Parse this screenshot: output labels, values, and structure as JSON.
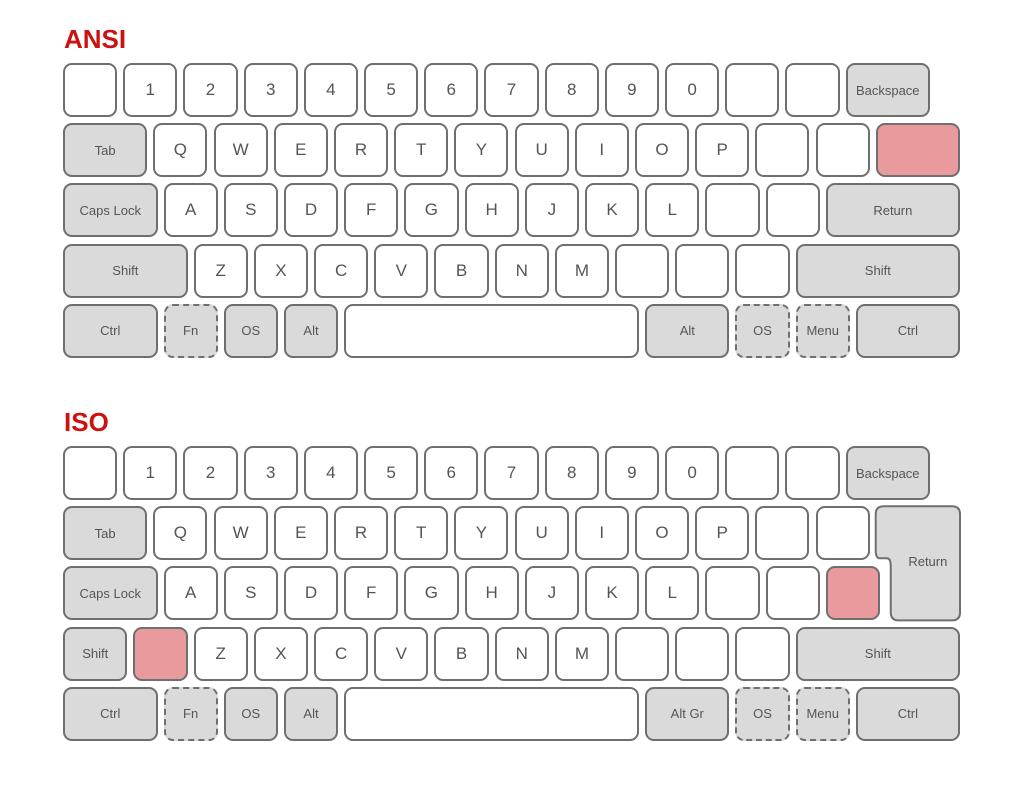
{
  "colors": {
    "title": "#cc1111",
    "modifier": "#dadada",
    "highlight": "#e99a9c",
    "key": "#ffffff",
    "border": "#6f6f6f"
  },
  "ansi": {
    "title": "ANSI",
    "rows": [
      [
        {
          "l": "",
          "w": 1
        },
        {
          "l": "1",
          "w": 1
        },
        {
          "l": "2",
          "w": 1
        },
        {
          "l": "3",
          "w": 1
        },
        {
          "l": "4",
          "w": 1
        },
        {
          "l": "5",
          "w": 1
        },
        {
          "l": "6",
          "w": 1
        },
        {
          "l": "7",
          "w": 1
        },
        {
          "l": "8",
          "w": 1
        },
        {
          "l": "9",
          "w": 1
        },
        {
          "l": "0",
          "w": 1
        },
        {
          "l": "",
          "w": 1
        },
        {
          "l": "",
          "w": 1
        },
        {
          "l": "Backspace",
          "w": 1.5,
          "mod": true
        }
      ],
      [
        {
          "l": "Tab",
          "w": 1.5,
          "mod": true
        },
        {
          "l": "Q",
          "w": 1
        },
        {
          "l": "W",
          "w": 1
        },
        {
          "l": "E",
          "w": 1
        },
        {
          "l": "R",
          "w": 1
        },
        {
          "l": "T",
          "w": 1
        },
        {
          "l": "Y",
          "w": 1
        },
        {
          "l": "U",
          "w": 1
        },
        {
          "l": "I",
          "w": 1
        },
        {
          "l": "O",
          "w": 1
        },
        {
          "l": "P",
          "w": 1
        },
        {
          "l": "",
          "w": 1
        },
        {
          "l": "",
          "w": 1
        },
        {
          "l": "",
          "w": 1.5,
          "hl": true
        }
      ],
      [
        {
          "l": "Caps Lock",
          "w": 1.67,
          "mod": true
        },
        {
          "l": "A",
          "w": 1
        },
        {
          "l": "S",
          "w": 1
        },
        {
          "l": "D",
          "w": 1
        },
        {
          "l": "F",
          "w": 1
        },
        {
          "l": "G",
          "w": 1
        },
        {
          "l": "H",
          "w": 1
        },
        {
          "l": "J",
          "w": 1
        },
        {
          "l": "K",
          "w": 1
        },
        {
          "l": "L",
          "w": 1
        },
        {
          "l": "",
          "w": 1
        },
        {
          "l": "",
          "w": 1
        },
        {
          "l": "Return",
          "w": 2.33,
          "mod": true
        }
      ],
      [
        {
          "l": "Shift",
          "w": 2.17,
          "mod": true
        },
        {
          "l": "Z",
          "w": 1
        },
        {
          "l": "X",
          "w": 1
        },
        {
          "l": "C",
          "w": 1
        },
        {
          "l": "V",
          "w": 1
        },
        {
          "l": "B",
          "w": 1
        },
        {
          "l": "N",
          "w": 1
        },
        {
          "l": "M",
          "w": 1
        },
        {
          "l": "",
          "w": 1
        },
        {
          "l": "",
          "w": 1
        },
        {
          "l": "",
          "w": 1
        },
        {
          "l": "Shift",
          "w": 2.83,
          "mod": true
        }
      ],
      [
        {
          "l": "Ctrl",
          "w": 1.67,
          "mod": true
        },
        {
          "l": "Fn",
          "w": 1,
          "mod": true,
          "dashed": true
        },
        {
          "l": "OS",
          "w": 1,
          "mod": true
        },
        {
          "l": "Alt",
          "w": 1,
          "mod": true
        },
        {
          "l": "",
          "w": 5
        },
        {
          "l": "Alt",
          "w": 1.5,
          "mod": true
        },
        {
          "l": "OS",
          "w": 1,
          "mod": true,
          "dashed": true
        },
        {
          "l": "Menu",
          "w": 1,
          "mod": true,
          "dashed": true
        },
        {
          "l": "Ctrl",
          "w": 1.83,
          "mod": true
        }
      ]
    ]
  },
  "iso": {
    "title": "ISO",
    "return_label": "Return",
    "rows": [
      [
        {
          "l": "",
          "w": 1
        },
        {
          "l": "1",
          "w": 1
        },
        {
          "l": "2",
          "w": 1
        },
        {
          "l": "3",
          "w": 1
        },
        {
          "l": "4",
          "w": 1
        },
        {
          "l": "5",
          "w": 1
        },
        {
          "l": "6",
          "w": 1
        },
        {
          "l": "7",
          "w": 1
        },
        {
          "l": "8",
          "w": 1
        },
        {
          "l": "9",
          "w": 1
        },
        {
          "l": "0",
          "w": 1
        },
        {
          "l": "",
          "w": 1
        },
        {
          "l": "",
          "w": 1
        },
        {
          "l": "Backspace",
          "w": 1.5,
          "mod": true
        }
      ],
      [
        {
          "l": "Tab",
          "w": 1.5,
          "mod": true
        },
        {
          "l": "Q",
          "w": 1
        },
        {
          "l": "W",
          "w": 1
        },
        {
          "l": "E",
          "w": 1
        },
        {
          "l": "R",
          "w": 1
        },
        {
          "l": "T",
          "w": 1
        },
        {
          "l": "Y",
          "w": 1
        },
        {
          "l": "U",
          "w": 1
        },
        {
          "l": "I",
          "w": 1
        },
        {
          "l": "O",
          "w": 1
        },
        {
          "l": "P",
          "w": 1
        },
        {
          "l": "",
          "w": 1
        },
        {
          "l": "",
          "w": 1
        }
      ],
      [
        {
          "l": "Caps Lock",
          "w": 1.67,
          "mod": true
        },
        {
          "l": "A",
          "w": 1
        },
        {
          "l": "S",
          "w": 1
        },
        {
          "l": "D",
          "w": 1
        },
        {
          "l": "F",
          "w": 1
        },
        {
          "l": "G",
          "w": 1
        },
        {
          "l": "H",
          "w": 1
        },
        {
          "l": "J",
          "w": 1
        },
        {
          "l": "K",
          "w": 1
        },
        {
          "l": "L",
          "w": 1
        },
        {
          "l": "",
          "w": 1
        },
        {
          "l": "",
          "w": 1
        },
        {
          "l": "",
          "w": 1,
          "hl": true
        }
      ],
      [
        {
          "l": "Shift",
          "w": 1.17,
          "mod": true
        },
        {
          "l": "",
          "w": 1,
          "hl": true
        },
        {
          "l": "Z",
          "w": 1
        },
        {
          "l": "X",
          "w": 1
        },
        {
          "l": "C",
          "w": 1
        },
        {
          "l": "V",
          "w": 1
        },
        {
          "l": "B",
          "w": 1
        },
        {
          "l": "N",
          "w": 1
        },
        {
          "l": "M",
          "w": 1
        },
        {
          "l": "",
          "w": 1
        },
        {
          "l": "",
          "w": 1
        },
        {
          "l": "",
          "w": 1
        },
        {
          "l": "Shift",
          "w": 2.83,
          "mod": true
        }
      ],
      [
        {
          "l": "Ctrl",
          "w": 1.67,
          "mod": true
        },
        {
          "l": "Fn",
          "w": 1,
          "mod": true,
          "dashed": true
        },
        {
          "l": "OS",
          "w": 1,
          "mod": true
        },
        {
          "l": "Alt",
          "w": 1,
          "mod": true
        },
        {
          "l": "",
          "w": 5
        },
        {
          "l": "Alt Gr",
          "w": 1.5,
          "mod": true
        },
        {
          "l": "OS",
          "w": 1,
          "mod": true,
          "dashed": true
        },
        {
          "l": "Menu",
          "w": 1,
          "mod": true,
          "dashed": true
        },
        {
          "l": "Ctrl",
          "w": 1.83,
          "mod": true
        }
      ]
    ]
  }
}
